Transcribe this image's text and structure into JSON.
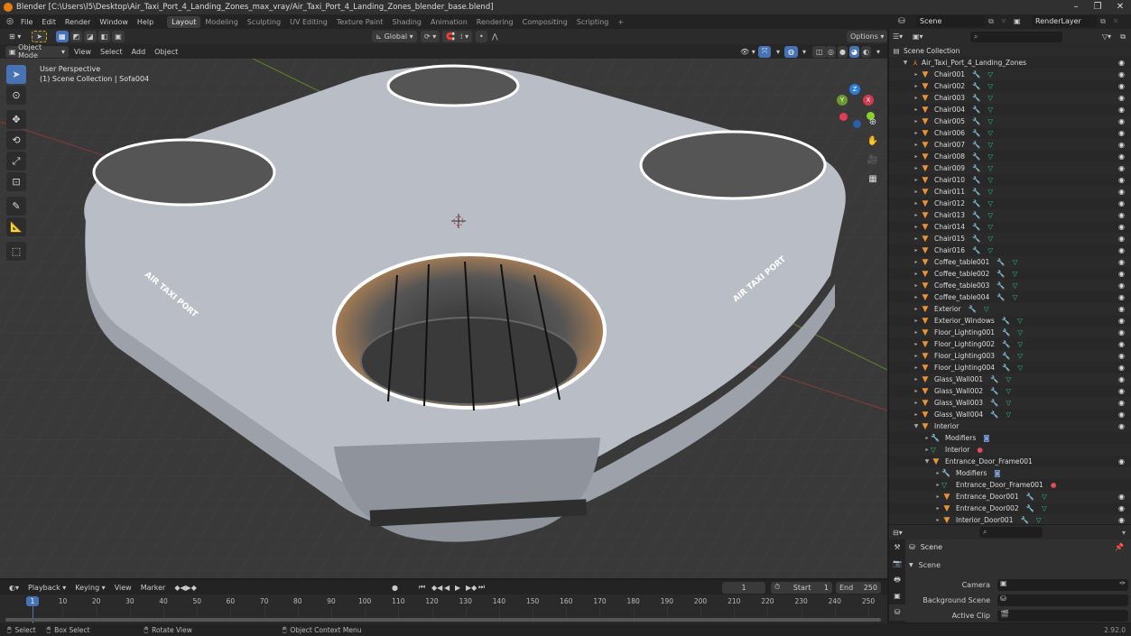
{
  "window": {
    "title": "Blender [C:\\Users\\l5\\Desktop\\Air_Taxi_Port_4_Landing_Zones_max_vray/Air_Taxi_Port_4_Landing_Zones_blender_base.blend]",
    "minimize": "–",
    "maximize": "❐",
    "close": "✕"
  },
  "menu": [
    "File",
    "Edit",
    "Render",
    "Window",
    "Help"
  ],
  "workspaces": [
    {
      "label": "Layout",
      "active": true
    },
    {
      "label": "Modeling"
    },
    {
      "label": "Sculpting"
    },
    {
      "label": "UV Editing"
    },
    {
      "label": "Texture Paint"
    },
    {
      "label": "Shading"
    },
    {
      "label": "Animation"
    },
    {
      "label": "Rendering"
    },
    {
      "label": "Compositing"
    },
    {
      "label": "Scripting"
    }
  ],
  "add_workspace": "+",
  "scene_selector": {
    "value": "Scene"
  },
  "renderlayer_selector": {
    "value": "RenderLayer"
  },
  "tool_header": {
    "orientation": "Global",
    "options": "Options"
  },
  "viewport_header": {
    "mode": "Object Mode",
    "menus": [
      "View",
      "Select",
      "Add",
      "Object"
    ]
  },
  "viewport": {
    "perspective": "User Perspective",
    "collection_info": "(1) Scene Collection | Sofa004"
  },
  "gizmo": {
    "x": "X",
    "y": "Y",
    "z": "Z"
  },
  "outliner": {
    "search_placeholder": "",
    "root": "Scene Collection",
    "collection": "Air_Taxi_Port_4_Landing_Zones",
    "items": [
      "Chair001",
      "Chair002",
      "Chair003",
      "Chair004",
      "Chair005",
      "Chair006",
      "Chair007",
      "Chair008",
      "Chair009",
      "Chair010",
      "Chair011",
      "Chair012",
      "Chair013",
      "Chair014",
      "Chair015",
      "Chair016",
      "Coffee_table001",
      "Coffee_table002",
      "Coffee_table003",
      "Coffee_table004",
      "Exterior",
      "Exterior_Windows",
      "Floor_Lighting001",
      "Floor_Lighting002",
      "Floor_Lighting003",
      "Floor_Lighting004",
      "Glass_Wall001",
      "Glass_Wall002",
      "Glass_Wall003",
      "Glass_Wall004",
      "Interior"
    ],
    "interior_children": [
      {
        "label": "Modifiers",
        "type": "modifiers",
        "depth": 2
      },
      {
        "label": "Interior",
        "type": "mesh-data",
        "depth": 2
      },
      {
        "label": "Entrance_Door_Frame001",
        "type": "object",
        "depth": 2,
        "expanded": true
      },
      {
        "label": "Modifiers",
        "type": "modifiers",
        "depth": 3
      },
      {
        "label": "Entrance_Door_Frame001",
        "type": "mesh-data",
        "depth": 3
      },
      {
        "label": "Entrance_Door001",
        "type": "object",
        "depth": 3
      },
      {
        "label": "Entrance_Door002",
        "type": "object",
        "depth": 3
      },
      {
        "label": "Interior_Door001",
        "type": "object",
        "depth": 3
      }
    ]
  },
  "properties": {
    "context": "Scene",
    "panel": "Scene",
    "fields": [
      {
        "label": "Camera",
        "value": ""
      },
      {
        "label": "Background Scene",
        "value": ""
      },
      {
        "label": "Active Clip",
        "value": ""
      }
    ]
  },
  "timeline": {
    "menus": [
      "Playback",
      "Keying",
      "View",
      "Marker"
    ],
    "current_frame": "1",
    "start_label": "Start",
    "start": "1",
    "end_label": "End",
    "end": "250",
    "ticks": [
      "10",
      "20",
      "30",
      "40",
      "50",
      "60",
      "70",
      "80",
      "90",
      "100",
      "110",
      "120",
      "130",
      "140",
      "150",
      "160",
      "170",
      "180",
      "190",
      "200",
      "210",
      "220",
      "230",
      "240",
      "250"
    ],
    "playhead": "1"
  },
  "statusbar": {
    "select": "Select",
    "box_select": "Box Select",
    "rotate": "Rotate View",
    "context": "Object Context Menu",
    "version": "2.92.0"
  }
}
